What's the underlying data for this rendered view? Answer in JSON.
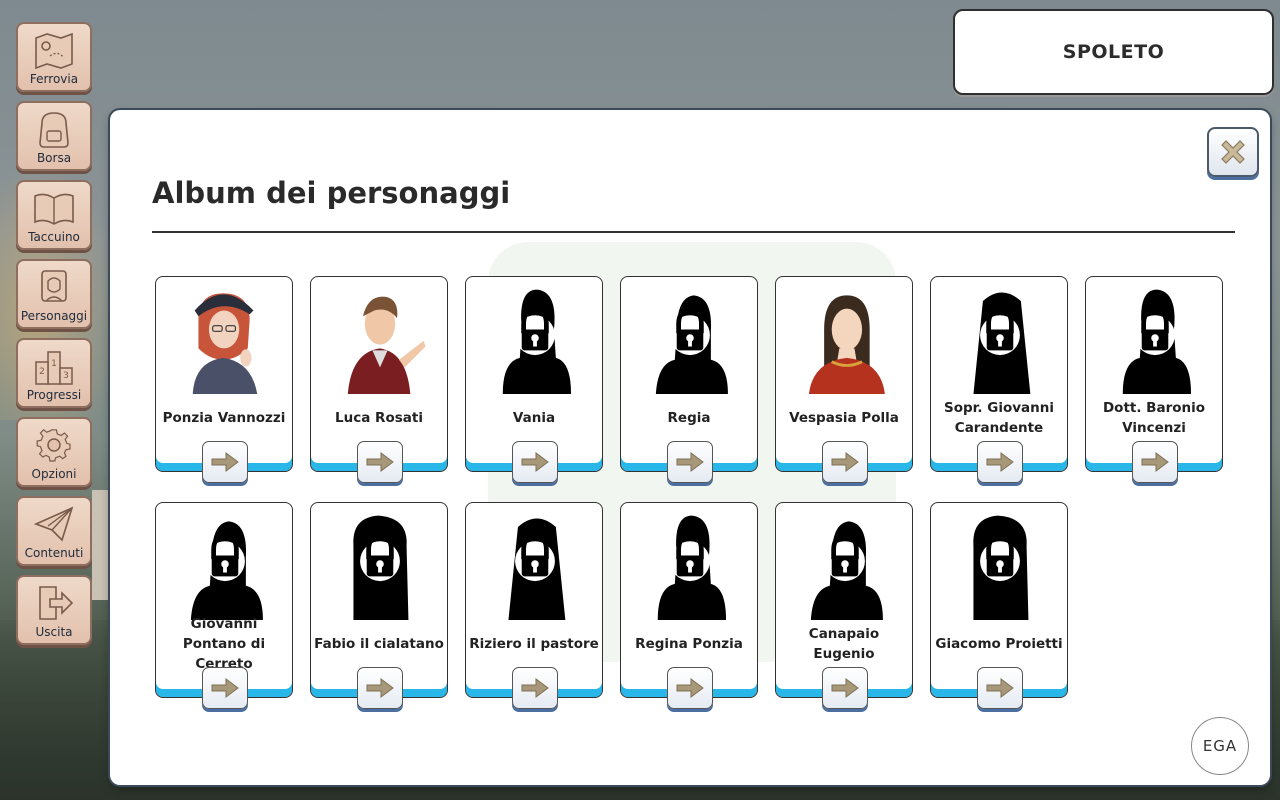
{
  "location": {
    "name": "SPOLETO"
  },
  "sidebar": {
    "items": [
      {
        "label": "Ferrovia",
        "icon": "map-icon"
      },
      {
        "label": "Borsa",
        "icon": "backpack-icon"
      },
      {
        "label": "Taccuino",
        "icon": "book-icon"
      },
      {
        "label": "Personaggi",
        "icon": "character-icon"
      },
      {
        "label": "Progressi",
        "icon": "podium-icon"
      },
      {
        "label": "Opzioni",
        "icon": "gear-icon"
      },
      {
        "label": "Contenuti",
        "icon": "paper-plane-icon"
      },
      {
        "label": "Uscita",
        "icon": "exit-icon"
      }
    ]
  },
  "panel": {
    "title": "Album dei personaggi",
    "close_icon": "close-icon",
    "corner_logo": "EGA"
  },
  "characters": [
    {
      "name": "Ponzia Vannozzi",
      "unlocked": true
    },
    {
      "name": "Luca Rosati",
      "unlocked": true
    },
    {
      "name": "Vania",
      "unlocked": false
    },
    {
      "name": "Regia",
      "unlocked": false
    },
    {
      "name": "Vespasia Polla",
      "unlocked": true
    },
    {
      "name": "Sopr. Giovanni Carandente",
      "unlocked": false
    },
    {
      "name": "Dott. Baronio Vincenzi",
      "unlocked": false
    },
    {
      "name": "Giovanni Pontano di Cerreto",
      "unlocked": false
    },
    {
      "name": "Fabio il cialatano",
      "unlocked": false
    },
    {
      "name": "Riziero il pastore",
      "unlocked": false
    },
    {
      "name": "Regina Ponzia",
      "unlocked": false
    },
    {
      "name": "Canapaio Eugenio",
      "unlocked": false
    },
    {
      "name": "Giacomo Proietti",
      "unlocked": false
    }
  ],
  "colors": {
    "card_accent": "#29b6e8",
    "sidebar_button": "#e2c1ad",
    "arrow": "#a8987a"
  }
}
